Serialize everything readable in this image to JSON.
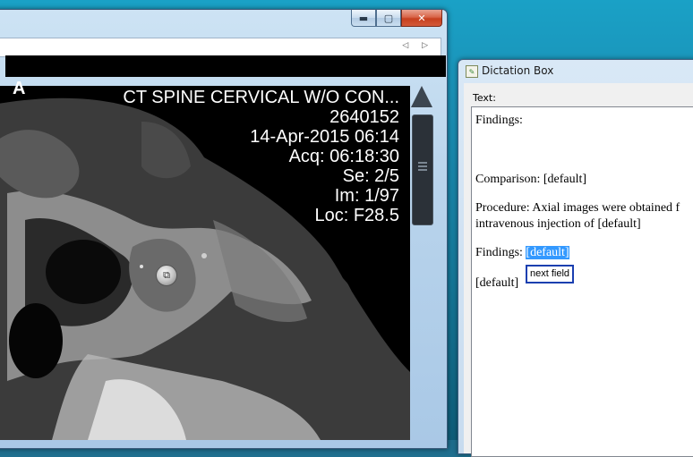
{
  "viewer": {
    "caption_minimize": "▬",
    "caption_maximize": "▢",
    "caption_close": "✕",
    "tab_nav": "◁ ▷",
    "overlay": {
      "corner": "A",
      "lines": [
        "CT SPINE CERVICAL W/O CON...",
        "2640152",
        "14-Apr-2015 06:14",
        "Acq: 06:18:30",
        "Se: 2/5",
        "Im: 1/97",
        "Loc: F28.5"
      ]
    }
  },
  "dictation": {
    "title": "Dictation Box",
    "text_label": "Text:",
    "findings_heading": "Findings:",
    "comparison": "Comparison: [default]",
    "procedure_line1": "Procedure: Axial images were obtained f",
    "procedure_line2": "intravenous injection of [default]",
    "findings_label": "Findings: ",
    "findings_selected": "[default]",
    "tooltip": "next field",
    "trailing_default": "[default]"
  }
}
